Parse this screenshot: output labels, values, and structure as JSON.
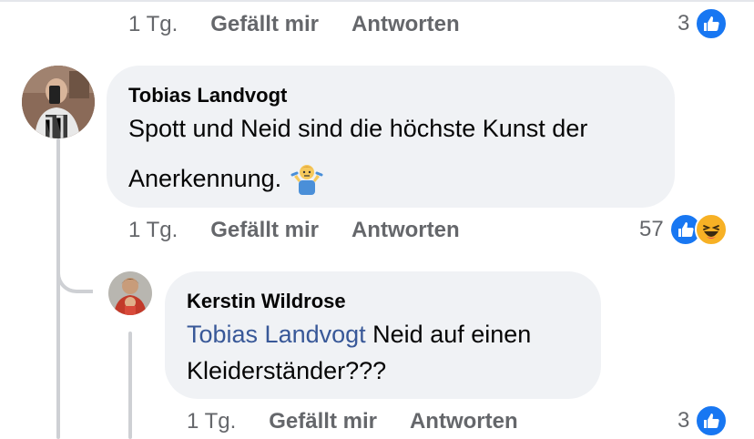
{
  "comments": [
    {
      "time": "1 Tg.",
      "like_label": "Gefällt mir",
      "reply_label": "Antworten",
      "reaction_count": "3",
      "reactions": [
        "like"
      ]
    },
    {
      "author": "Tobias Landvogt",
      "text_line1": "Spott und Neid sind die höchste Kunst der",
      "text_line2": "Anerkennung.",
      "emoji": "man-shrugging",
      "time": "1 Tg.",
      "like_label": "Gefällt mir",
      "reply_label": "Antworten",
      "reaction_count": "57",
      "reactions": [
        "like",
        "haha"
      ]
    },
    {
      "author": "Kerstin Wildrose",
      "mention": "Tobias Landvogt",
      "text_rest": " Neid auf einen",
      "text_line2": "Kleiderständer???",
      "time": "1 Tg.",
      "like_label": "Gefällt mir",
      "reply_label": "Antworten",
      "reaction_count": "3",
      "reactions": [
        "like"
      ]
    }
  ],
  "colors": {
    "bubble": "#f0f2f5",
    "meta_text": "#65676b",
    "mention": "#385898",
    "like_blue": "#1877f2",
    "haha_yellow": "#f7b125",
    "thread_line": "#ced0d4"
  }
}
